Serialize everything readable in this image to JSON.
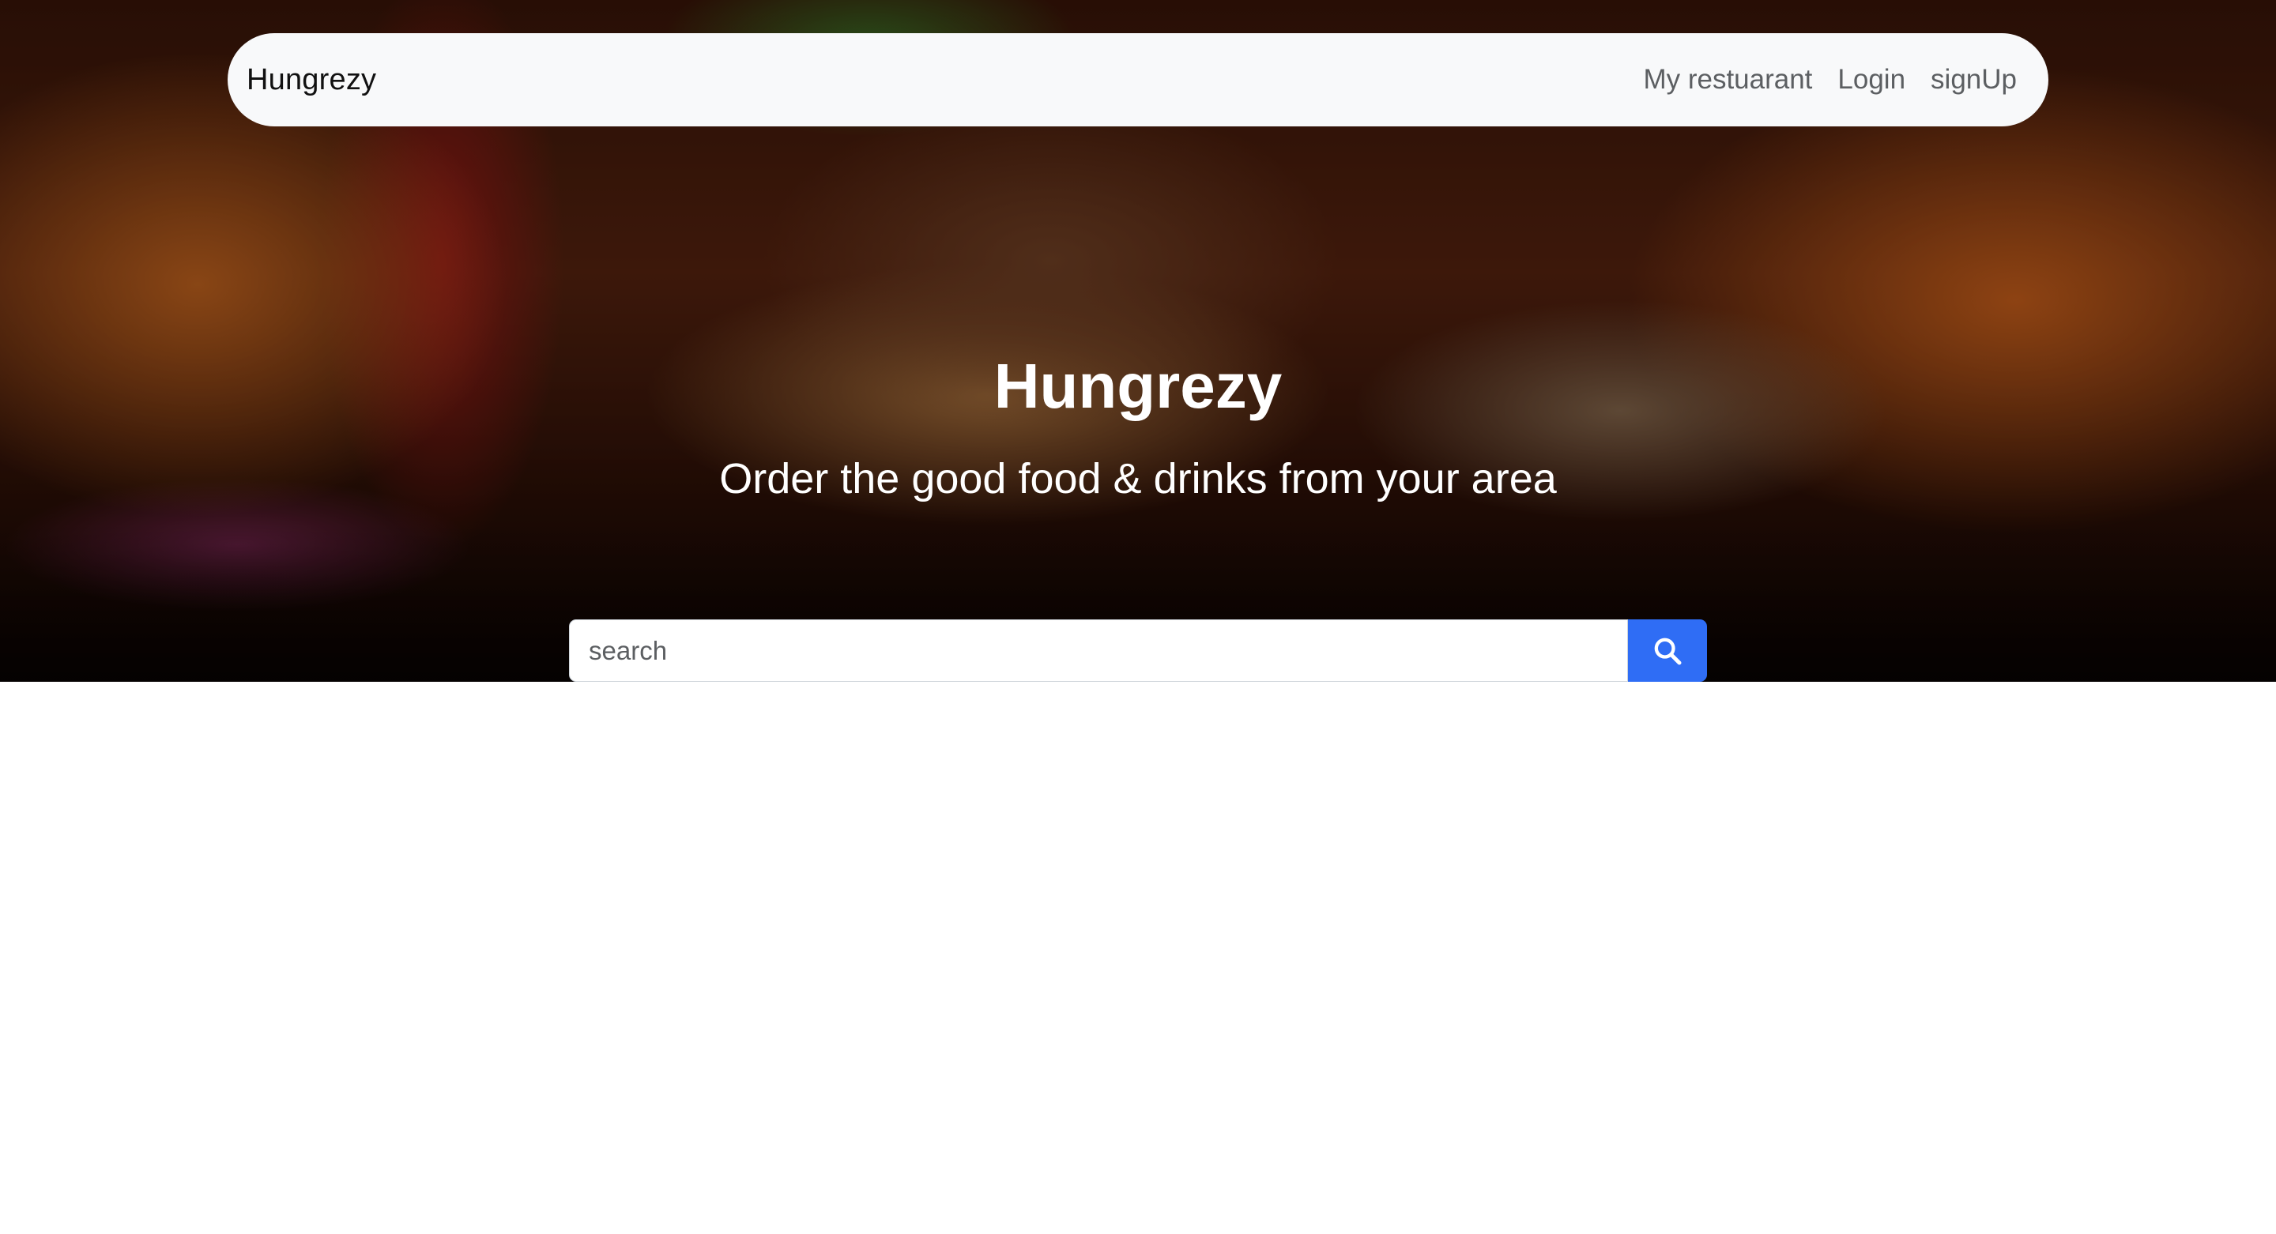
{
  "navbar": {
    "brand": "Hungrezy",
    "links": [
      {
        "label": "My restuarant"
      },
      {
        "label": "Login"
      },
      {
        "label": "signUp"
      }
    ]
  },
  "hero": {
    "title": "Hungrezy",
    "subtitle": "Order the good food & drinks from your area",
    "background_image": "burger-on-flames-photo"
  },
  "search": {
    "placeholder": "search",
    "value": "",
    "button_icon": "search-icon"
  },
  "colors": {
    "navbar_bg": "#f8f9fa",
    "accent": "#2f6df5",
    "hero_text": "#ffffff",
    "page_bg": "#ffffff"
  }
}
